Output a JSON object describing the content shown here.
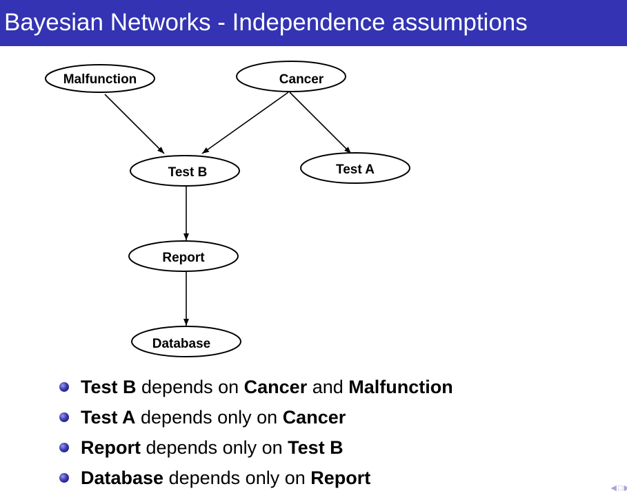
{
  "title": "Bayesian Networks - Independence assumptions",
  "colors": {
    "title_bar": "#3333b3",
    "title_text": "#ffffff",
    "bullet": "#3b3bb0",
    "nav": "#a6a6d9"
  },
  "nodes": {
    "malfunction": "Malfunction",
    "cancer": "Cancer",
    "test_b": "Test B",
    "test_a": "Test A",
    "report": "Report",
    "database": "Database"
  },
  "edges": [
    [
      "Malfunction",
      "Test B"
    ],
    [
      "Cancer",
      "Test B"
    ],
    [
      "Cancer",
      "Test A"
    ],
    [
      "Test B",
      "Report"
    ],
    [
      "Report",
      "Database"
    ]
  ],
  "bullets": [
    {
      "subject": "Test B",
      "middle": " depends on ",
      "obj1": "Cancer",
      "conj": " and ",
      "obj2": "Malfunction"
    },
    {
      "subject": "Test A",
      "middle": " depends only on ",
      "obj1": "Cancer"
    },
    {
      "subject": "Report",
      "middle": " depends only on ",
      "obj1": "Test B"
    },
    {
      "subject": "Database",
      "middle": " depends only on ",
      "obj1": "Report"
    }
  ],
  "nav": {
    "prev_icon": "triangle-left-icon",
    "frame_icon": "frame-icon",
    "next_icon": "triangle-right-icon"
  }
}
